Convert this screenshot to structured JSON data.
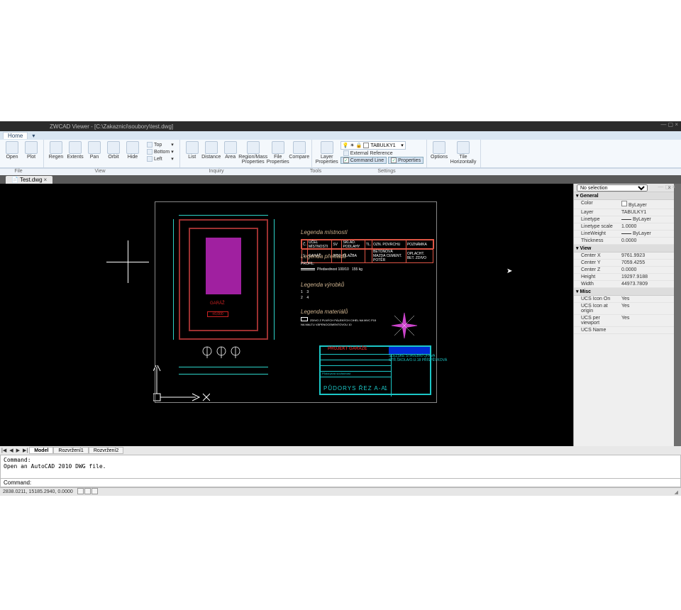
{
  "title": "ZWCAD Viewer - [C:\\Zakaznici\\soubory\\test.dwg]",
  "menu": {
    "home": "Home"
  },
  "ribbon": {
    "file": {
      "open": "Open",
      "plot": "Plot",
      "regen": "Regen",
      "extents": "Extents",
      "pan": "Pan",
      "orbit": "Orbit",
      "hide": "Hide",
      "top": "Top",
      "bottom": "Bottom",
      "left": "Left"
    },
    "inquiry": {
      "list": "List",
      "distance": "Distance",
      "area": "Area",
      "region": "Region/Mass\nProperties",
      "fileprops": "File\nProperties",
      "compare": "Compare"
    },
    "tools": {
      "layerprops": "Layer\nProperties",
      "layer_combo": "TABULKY1",
      "extref": "External Reference",
      "cmdline": "Command Line",
      "props": "Properties"
    },
    "settings": {
      "options": "Options",
      "tile": "Tile\nHorizontally"
    },
    "bar": {
      "file": "File",
      "view": "View",
      "inquiry": "Inquiry",
      "tools": "Tools",
      "settings": "Settings"
    }
  },
  "doc_tab": "Test.dwg",
  "drawing": {
    "legend_rooms": "Legenda místností",
    "legend_lintels": "Legenda překladů",
    "legend_products": "Legenda výrobků",
    "legend_materials": "Legenda materiálů",
    "profile_label": "PROFIL:",
    "profile_note": "Předsednost 100/10",
    "profile_val": "155 kg",
    "material_note": "ZDIVO Z PLNÝCH PÁLENÝCH CIHEL NA MVC P15\nNA MALTU VÁPENOCEMENTOVOU 10",
    "room_headers": [
      "Č.",
      "ÚČEL MÍSTNOSTI",
      "SV",
      "SKLAD. PODLAHY",
      "TL.",
      "OZN. POVRCHU",
      "POZNÁMKA"
    ],
    "room_row": [
      "1",
      "GARÁŽ",
      "2650",
      "DLAŽBA",
      "",
      "BETONOVÁ MAZDA\nCEMENT. POTĚR",
      "OPLACHT. BET.\nZDIVO"
    ],
    "project_label": "PROJEKT GARÁŽE",
    "school_lines": "SLEZSKÉ STAVEBNÍ OPAVA\nSTŘ.ŠKOLA/O.U.18 PŘÍSPĚVKOVÁ",
    "sheet_small": "Půdorysná souřadnost",
    "sheet_title": "PŮDORYS ŘEZ A-A",
    "sheet_no": "1",
    "room_tag": "GARÁŽ",
    "room_area_box": "±0,000"
  },
  "properties": {
    "selector": "No selection",
    "groups": {
      "general": "General",
      "view": "View",
      "misc": "Misc"
    },
    "rows": {
      "Color": "ByLayer",
      "Layer": "TABULKY1",
      "Linetype": "ByLayer",
      "Linetype scale": "1.0000",
      "LineWeight": "ByLayer",
      "Thickness": "0.0000",
      "Center X": "9761.9923",
      "Center Y": "7059.4255",
      "Center Z": "0.0000",
      "Height": "19297.9188",
      "Width": "44973.7809",
      "UCS Icon On": "Yes",
      "UCS Icon at origin": "Yes",
      "UCS per viewport": "Yes",
      "UCS Name": ""
    }
  },
  "bottom_tabs": {
    "model": "Model",
    "l1": "Rozvržení1",
    "l2": "Rozvržení2"
  },
  "command": {
    "history": "Command:\nOpen an AutoCAD 2010 DWG file.",
    "prompt": "Command:"
  },
  "status": {
    "coords": "2838.0211, 15185.2940, 0.0000"
  }
}
